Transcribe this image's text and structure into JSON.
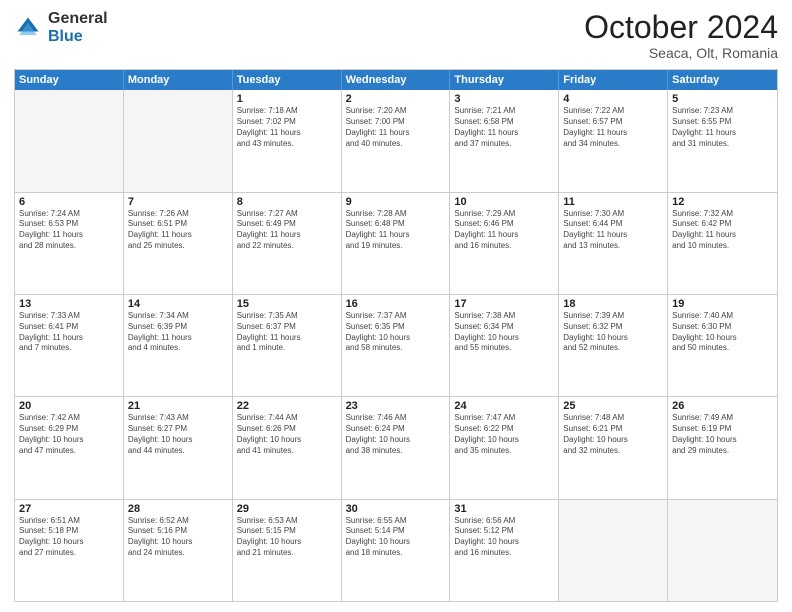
{
  "logo": {
    "general": "General",
    "blue": "Blue"
  },
  "header": {
    "month": "October 2024",
    "location": "Seaca, Olt, Romania"
  },
  "days": [
    "Sunday",
    "Monday",
    "Tuesday",
    "Wednesday",
    "Thursday",
    "Friday",
    "Saturday"
  ],
  "rows": [
    [
      {
        "day": "",
        "lines": []
      },
      {
        "day": "",
        "lines": []
      },
      {
        "day": "1",
        "lines": [
          "Sunrise: 7:18 AM",
          "Sunset: 7:02 PM",
          "Daylight: 11 hours",
          "and 43 minutes."
        ]
      },
      {
        "day": "2",
        "lines": [
          "Sunrise: 7:20 AM",
          "Sunset: 7:00 PM",
          "Daylight: 11 hours",
          "and 40 minutes."
        ]
      },
      {
        "day": "3",
        "lines": [
          "Sunrise: 7:21 AM",
          "Sunset: 6:58 PM",
          "Daylight: 11 hours",
          "and 37 minutes."
        ]
      },
      {
        "day": "4",
        "lines": [
          "Sunrise: 7:22 AM",
          "Sunset: 6:57 PM",
          "Daylight: 11 hours",
          "and 34 minutes."
        ]
      },
      {
        "day": "5",
        "lines": [
          "Sunrise: 7:23 AM",
          "Sunset: 6:55 PM",
          "Daylight: 11 hours",
          "and 31 minutes."
        ]
      }
    ],
    [
      {
        "day": "6",
        "lines": [
          "Sunrise: 7:24 AM",
          "Sunset: 6:53 PM",
          "Daylight: 11 hours",
          "and 28 minutes."
        ]
      },
      {
        "day": "7",
        "lines": [
          "Sunrise: 7:26 AM",
          "Sunset: 6:51 PM",
          "Daylight: 11 hours",
          "and 25 minutes."
        ]
      },
      {
        "day": "8",
        "lines": [
          "Sunrise: 7:27 AM",
          "Sunset: 6:49 PM",
          "Daylight: 11 hours",
          "and 22 minutes."
        ]
      },
      {
        "day": "9",
        "lines": [
          "Sunrise: 7:28 AM",
          "Sunset: 6:48 PM",
          "Daylight: 11 hours",
          "and 19 minutes."
        ]
      },
      {
        "day": "10",
        "lines": [
          "Sunrise: 7:29 AM",
          "Sunset: 6:46 PM",
          "Daylight: 11 hours",
          "and 16 minutes."
        ]
      },
      {
        "day": "11",
        "lines": [
          "Sunrise: 7:30 AM",
          "Sunset: 6:44 PM",
          "Daylight: 11 hours",
          "and 13 minutes."
        ]
      },
      {
        "day": "12",
        "lines": [
          "Sunrise: 7:32 AM",
          "Sunset: 6:42 PM",
          "Daylight: 11 hours",
          "and 10 minutes."
        ]
      }
    ],
    [
      {
        "day": "13",
        "lines": [
          "Sunrise: 7:33 AM",
          "Sunset: 6:41 PM",
          "Daylight: 11 hours",
          "and 7 minutes."
        ]
      },
      {
        "day": "14",
        "lines": [
          "Sunrise: 7:34 AM",
          "Sunset: 6:39 PM",
          "Daylight: 11 hours",
          "and 4 minutes."
        ]
      },
      {
        "day": "15",
        "lines": [
          "Sunrise: 7:35 AM",
          "Sunset: 6:37 PM",
          "Daylight: 11 hours",
          "and 1 minute."
        ]
      },
      {
        "day": "16",
        "lines": [
          "Sunrise: 7:37 AM",
          "Sunset: 6:35 PM",
          "Daylight: 10 hours",
          "and 58 minutes."
        ]
      },
      {
        "day": "17",
        "lines": [
          "Sunrise: 7:38 AM",
          "Sunset: 6:34 PM",
          "Daylight: 10 hours",
          "and 55 minutes."
        ]
      },
      {
        "day": "18",
        "lines": [
          "Sunrise: 7:39 AM",
          "Sunset: 6:32 PM",
          "Daylight: 10 hours",
          "and 52 minutes."
        ]
      },
      {
        "day": "19",
        "lines": [
          "Sunrise: 7:40 AM",
          "Sunset: 6:30 PM",
          "Daylight: 10 hours",
          "and 50 minutes."
        ]
      }
    ],
    [
      {
        "day": "20",
        "lines": [
          "Sunrise: 7:42 AM",
          "Sunset: 6:29 PM",
          "Daylight: 10 hours",
          "and 47 minutes."
        ]
      },
      {
        "day": "21",
        "lines": [
          "Sunrise: 7:43 AM",
          "Sunset: 6:27 PM",
          "Daylight: 10 hours",
          "and 44 minutes."
        ]
      },
      {
        "day": "22",
        "lines": [
          "Sunrise: 7:44 AM",
          "Sunset: 6:26 PM",
          "Daylight: 10 hours",
          "and 41 minutes."
        ]
      },
      {
        "day": "23",
        "lines": [
          "Sunrise: 7:46 AM",
          "Sunset: 6:24 PM",
          "Daylight: 10 hours",
          "and 38 minutes."
        ]
      },
      {
        "day": "24",
        "lines": [
          "Sunrise: 7:47 AM",
          "Sunset: 6:22 PM",
          "Daylight: 10 hours",
          "and 35 minutes."
        ]
      },
      {
        "day": "25",
        "lines": [
          "Sunrise: 7:48 AM",
          "Sunset: 6:21 PM",
          "Daylight: 10 hours",
          "and 32 minutes."
        ]
      },
      {
        "day": "26",
        "lines": [
          "Sunrise: 7:49 AM",
          "Sunset: 6:19 PM",
          "Daylight: 10 hours",
          "and 29 minutes."
        ]
      }
    ],
    [
      {
        "day": "27",
        "lines": [
          "Sunrise: 6:51 AM",
          "Sunset: 5:18 PM",
          "Daylight: 10 hours",
          "and 27 minutes."
        ]
      },
      {
        "day": "28",
        "lines": [
          "Sunrise: 6:52 AM",
          "Sunset: 5:16 PM",
          "Daylight: 10 hours",
          "and 24 minutes."
        ]
      },
      {
        "day": "29",
        "lines": [
          "Sunrise: 6:53 AM",
          "Sunset: 5:15 PM",
          "Daylight: 10 hours",
          "and 21 minutes."
        ]
      },
      {
        "day": "30",
        "lines": [
          "Sunrise: 6:55 AM",
          "Sunset: 5:14 PM",
          "Daylight: 10 hours",
          "and 18 minutes."
        ]
      },
      {
        "day": "31",
        "lines": [
          "Sunrise: 6:56 AM",
          "Sunset: 5:12 PM",
          "Daylight: 10 hours",
          "and 16 minutes."
        ]
      },
      {
        "day": "",
        "lines": []
      },
      {
        "day": "",
        "lines": []
      }
    ]
  ]
}
